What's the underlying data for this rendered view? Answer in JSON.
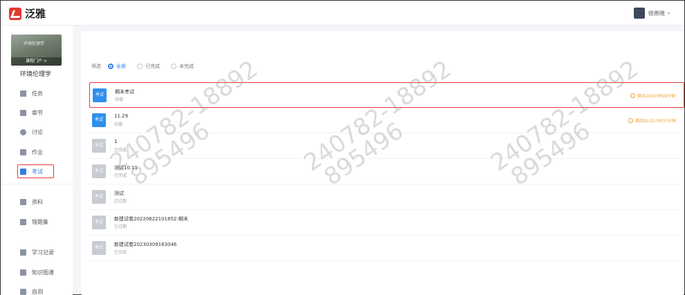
{
  "app": {
    "logo_text": "泛雅"
  },
  "user": {
    "name": "徐燕晓"
  },
  "sidebar": {
    "cover_title": "环境伦理学",
    "cover_button": "课程门户 >",
    "course_name": "环境伦理学",
    "items": [
      {
        "label": "任务",
        "icon": "grid-icon"
      },
      {
        "label": "章节",
        "icon": "chapter-icon"
      },
      {
        "label": "讨论",
        "icon": "chat-icon"
      },
      {
        "label": "作业",
        "icon": "homework-icon"
      },
      {
        "label": "考试",
        "icon": "exam-icon"
      },
      {
        "label": "资料",
        "icon": "folder-icon"
      },
      {
        "label": "错题集",
        "icon": "error-book-icon"
      },
      {
        "label": "学习记录",
        "icon": "record-icon"
      },
      {
        "label": "知识图谱",
        "icon": "graph-icon"
      },
      {
        "label": "自测",
        "icon": "selftest-icon"
      }
    ]
  },
  "filters": {
    "label": "筛选",
    "options": [
      "全部",
      "已完成",
      "未完成"
    ],
    "selected": "全部"
  },
  "exams": [
    {
      "badge": "考试",
      "title": "期末考试",
      "status": "待做",
      "deadline": "剩余283小时59分钟",
      "active": true
    },
    {
      "badge": "考试",
      "title": "11.29",
      "status": "待做",
      "deadline": "剩余9122小时37分钟",
      "active": true
    },
    {
      "badge": "考试",
      "title": "1",
      "status": "已完成",
      "deadline": "",
      "active": false
    },
    {
      "badge": "考试",
      "title": "测试10.11",
      "status": "已完成",
      "deadline": "",
      "active": false
    },
    {
      "badge": "考试",
      "title": "测试",
      "status": "已过期",
      "deadline": "",
      "active": false
    },
    {
      "badge": "考试",
      "title": "新建试卷20220622101852-期末",
      "status": "已过期",
      "deadline": "",
      "active": false
    },
    {
      "badge": "考试",
      "title": "新建试卷20230309163046",
      "status": "已完成",
      "deadline": "",
      "active": false
    }
  ],
  "watermark": {
    "line1": "240782-18892",
    "line2": "895496"
  },
  "colors": {
    "accent": "#2f7fe0",
    "highlight": "#e53935",
    "deadline": "#f0a030",
    "brand": "#e03a2f"
  }
}
